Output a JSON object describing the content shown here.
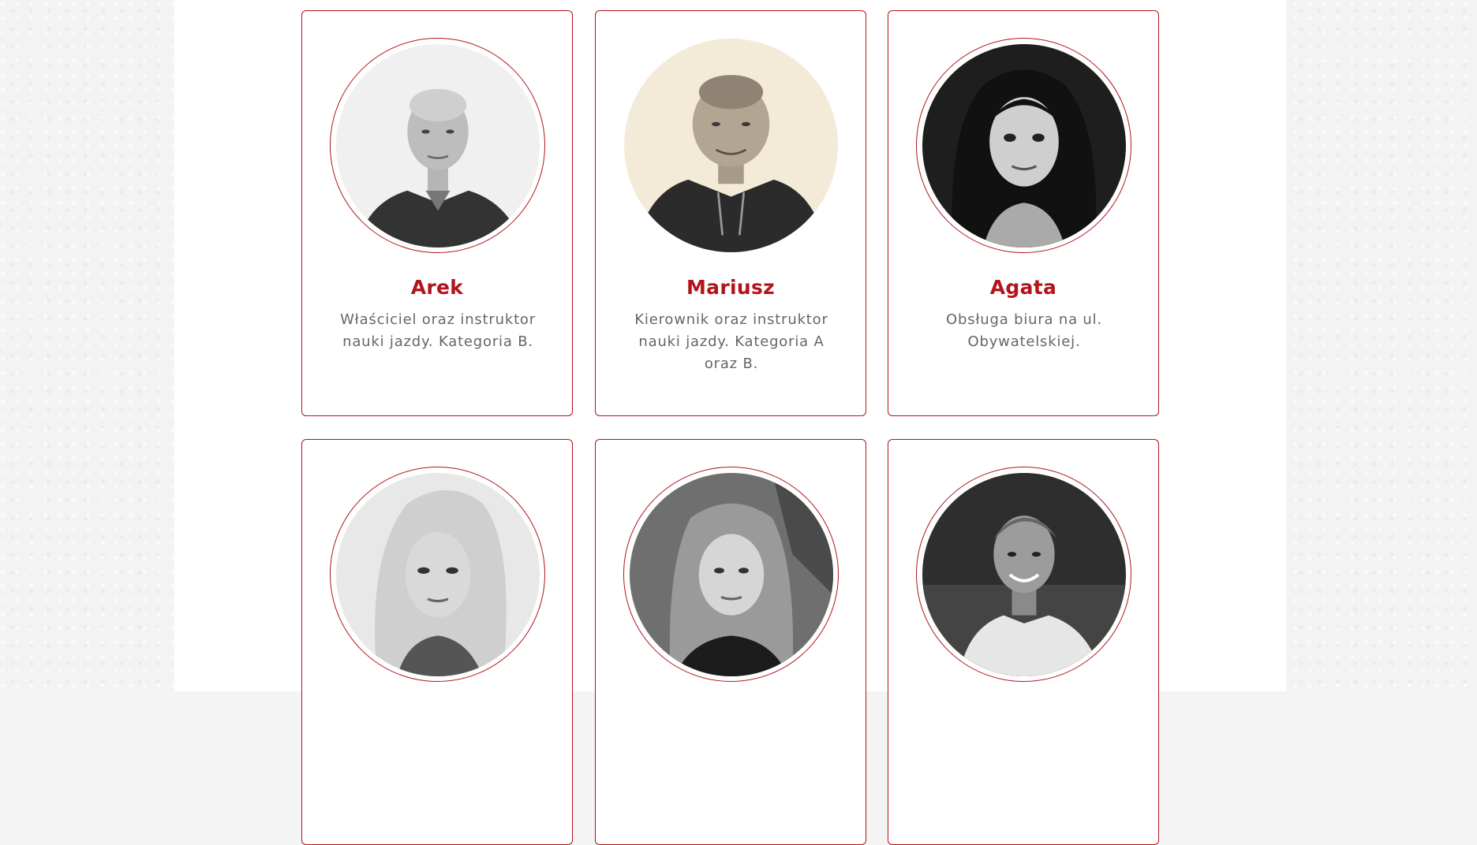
{
  "team": {
    "members": [
      {
        "name": "Arek",
        "role": "Właściciel oraz instruktor nauki jazdy. Kategoria B.",
        "photo": "portrait-photo"
      },
      {
        "name": "Mariusz",
        "role": "Kierownik oraz instruktor nauki jazdy. Kategoria A oraz B.",
        "photo": "portrait-photo"
      },
      {
        "name": "Agata",
        "role": "Obsługa biura na ul. Obywatelskiej.",
        "photo": "portrait-photo"
      },
      {
        "name": "",
        "role": "",
        "photo": "portrait-photo"
      },
      {
        "name": "",
        "role": "",
        "photo": "portrait-photo"
      },
      {
        "name": "",
        "role": "",
        "photo": "portrait-photo"
      }
    ]
  },
  "colors": {
    "accent": "#b3131b",
    "text_muted": "#666666",
    "page_background": "#f3f3f3",
    "content_background": "#ffffff"
  }
}
